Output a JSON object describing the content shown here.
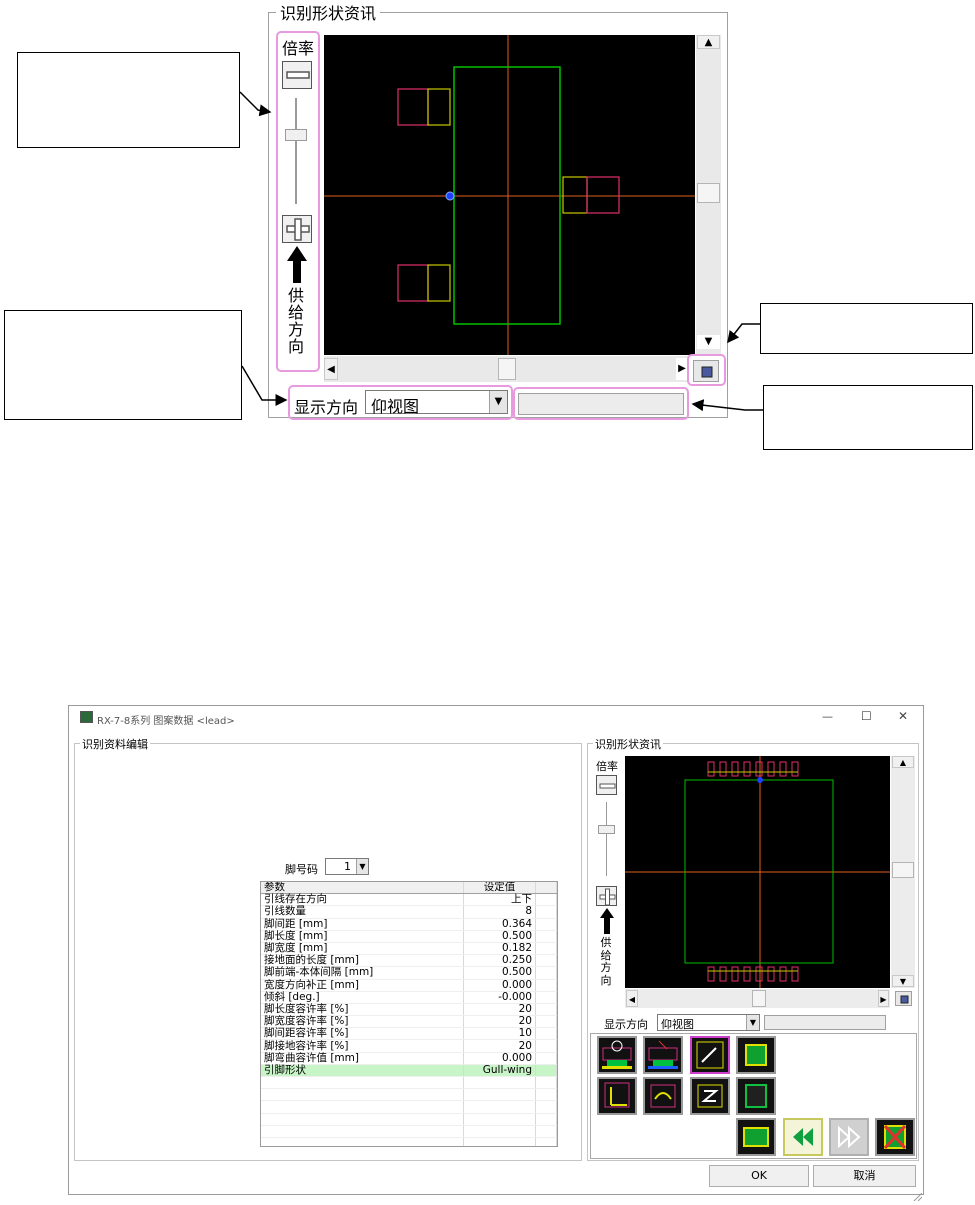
{
  "zoomed_panel": {
    "group_title": "识别形状资讯",
    "zoom_label": "倍率",
    "feed_direction_label": [
      "供",
      "给",
      "方",
      "向"
    ],
    "view_direction_label": "显示方向",
    "view_direction_value": "仰视图",
    "colors": {
      "highlight": "#e89adf",
      "body_outline": "#00c000",
      "pad_pink": "#e0306a",
      "pad_yellow": "#c8c800",
      "crosshair": "#e06020",
      "origin": "#2040ff",
      "canvas": "#000000"
    }
  },
  "dialog": {
    "title": "RX-7-8系列 图案数据 <lead>",
    "window_controls": {
      "minimize": "—",
      "maximize": "☐",
      "close": "✕"
    },
    "left_group_title": "识别资料编辑",
    "pin_no_label": "脚号码",
    "pin_no_value": "1",
    "table": {
      "headers": [
        "参数",
        "设定值"
      ],
      "rows": [
        [
          "引线存在方向",
          "上下"
        ],
        [
          "引线数量",
          "8"
        ],
        [
          "脚间距 [mm]",
          "0.364"
        ],
        [
          "脚长度 [mm]",
          "0.500"
        ],
        [
          "脚宽度 [mm]",
          "0.182"
        ],
        [
          "接地面的长度 [mm]",
          "0.250"
        ],
        [
          "脚前端-本体间隔 [mm]",
          "0.500"
        ],
        [
          "宽度方向补正 [mm]",
          "0.000"
        ],
        [
          "倾斜 [deg.]",
          "-0.000"
        ],
        [
          "脚长度容许率 [%]",
          "20"
        ],
        [
          "脚宽度容许率 [%]",
          "20"
        ],
        [
          "脚间距容许率 [%]",
          "10"
        ],
        [
          "脚接地容许率 [%]",
          "20"
        ],
        [
          "脚弯曲容许值 [mm]",
          "0.000"
        ],
        [
          "引脚形状",
          "Gull-wing"
        ]
      ],
      "selected_row": 14
    },
    "right_group_title": "识别形状资讯",
    "zoom_label": "倍率",
    "feed_direction_label": [
      "供",
      "给",
      "方",
      "向"
    ],
    "view_direction_label": "显示方向",
    "view_direction_value": "仰视图",
    "ok_label": "OK",
    "cancel_label": "取消"
  }
}
